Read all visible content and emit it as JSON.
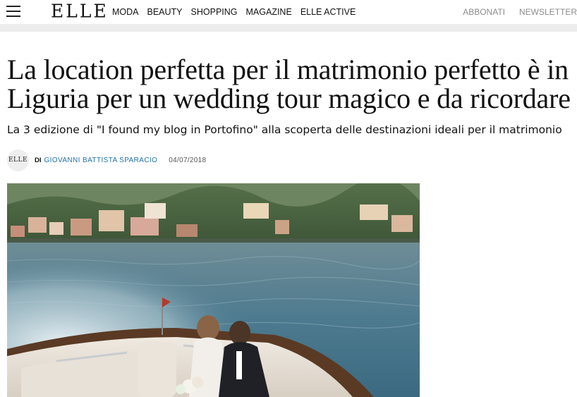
{
  "header": {
    "logo": "ELLE",
    "nav": [
      "MODA",
      "BEAUTY",
      "SHOPPING",
      "MAGAZINE",
      "ELLE ACTIVE"
    ],
    "utility": [
      "ABBONATI",
      "NEWSLETTER"
    ]
  },
  "article": {
    "headline": "La location perfetta per il matrimonio perfetto è in Liguria per un wedding tour magico e da ricordare",
    "subtitle": "La 3 edizione di \"I found my blog in Portofino\" alla scoperta delle destinazioni ideali per il matrimonio",
    "byline": {
      "avatar_text": "ELLE",
      "prefix": "DI",
      "author": "GIOVANNI BATTISTA SPARACIO",
      "date": "04/07/2018"
    },
    "hero_image": {
      "icon": "photo-couple-boat-portofino"
    }
  },
  "colors": {
    "author_link": "#1e73a8",
    "utility_text": "#8c8c8c",
    "sea": "#4d7a8f"
  }
}
